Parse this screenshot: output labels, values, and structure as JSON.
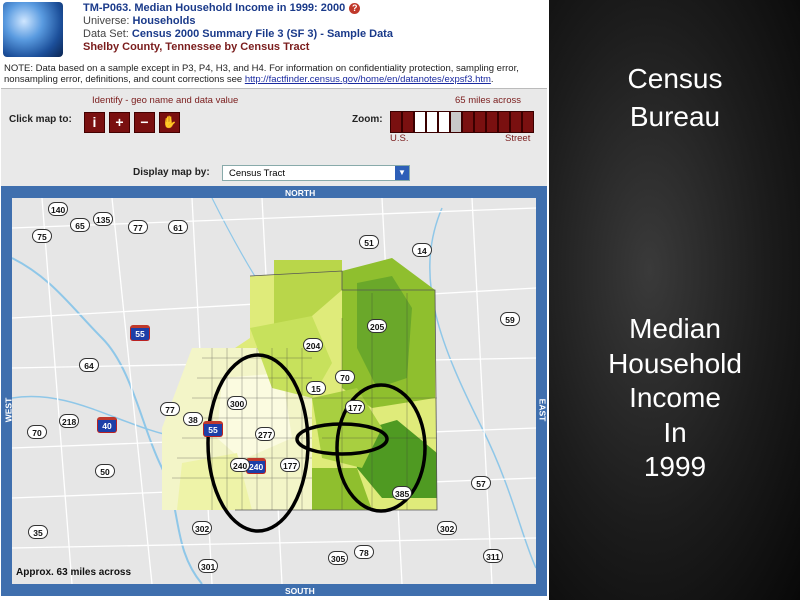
{
  "header": {
    "title": "TM-P063. Median Household Income in 1999: 2000",
    "universe_label": "Universe:",
    "universe_value": "Households",
    "dataset_label": "Data Set:",
    "dataset_value": "Census 2000 Summary File 3 (SF 3) - Sample Data",
    "geography": "Shelby County, Tennessee by Census Tract",
    "help_glyph": "?"
  },
  "note": {
    "text": "NOTE: Data based on a sample except in P3, P4, H3, and H4. For information on confidentiality protection, sampling error, nonsampling error, definitions, and count corrections see ",
    "link": "http://factfinder.census.gov/home/en/datanotes/expsf3.htm",
    "tail": "."
  },
  "controls": {
    "identify_hint": "Identify - geo name and data value",
    "click_map_label": "Click map to:",
    "zoom_label": "Zoom:",
    "zoom_scale_hint": "65 miles across",
    "zoom_left": "U.S.",
    "zoom_right": "Street",
    "display_by_label": "Display map by:",
    "display_by_value": "Census Tract",
    "tools": [
      {
        "name": "identify",
        "glyph": "i"
      },
      {
        "name": "zoom-in",
        "glyph": "+"
      },
      {
        "name": "zoom-out",
        "glyph": "−"
      },
      {
        "name": "pan",
        "glyph": "✋"
      }
    ],
    "zoom_level": 4
  },
  "map": {
    "north": "NORTH",
    "south": "SOUTH",
    "east": "EAST",
    "west": "WEST",
    "scale_text": "Approx. 63 miles across",
    "route_shields": [
      "140",
      "135",
      "65",
      "77",
      "61",
      "75",
      "51",
      "14",
      "59",
      "205",
      "204",
      "55",
      "64",
      "70",
      "15",
      "300",
      "77",
      "218",
      "40",
      "38",
      "55",
      "177",
      "70",
      "277",
      "240",
      "240",
      "177",
      "57",
      "50",
      "385",
      "302",
      "302",
      "35",
      "305",
      "78",
      "311",
      "301"
    ]
  },
  "slide": {
    "heading_line1": "Census",
    "heading_line2": "Bureau",
    "body_line1": "Median",
    "body_line2": "Household",
    "body_line3": "Income",
    "body_line4": "In",
    "body_line5": "1999"
  },
  "colors": {
    "panel_red": "#7a1010",
    "frame_blue": "#3f6fae",
    "income_light": "#f3f5c8",
    "income_mid": "#c7e15c",
    "income_high": "#8fbf2e",
    "income_top": "#4f9a22"
  }
}
